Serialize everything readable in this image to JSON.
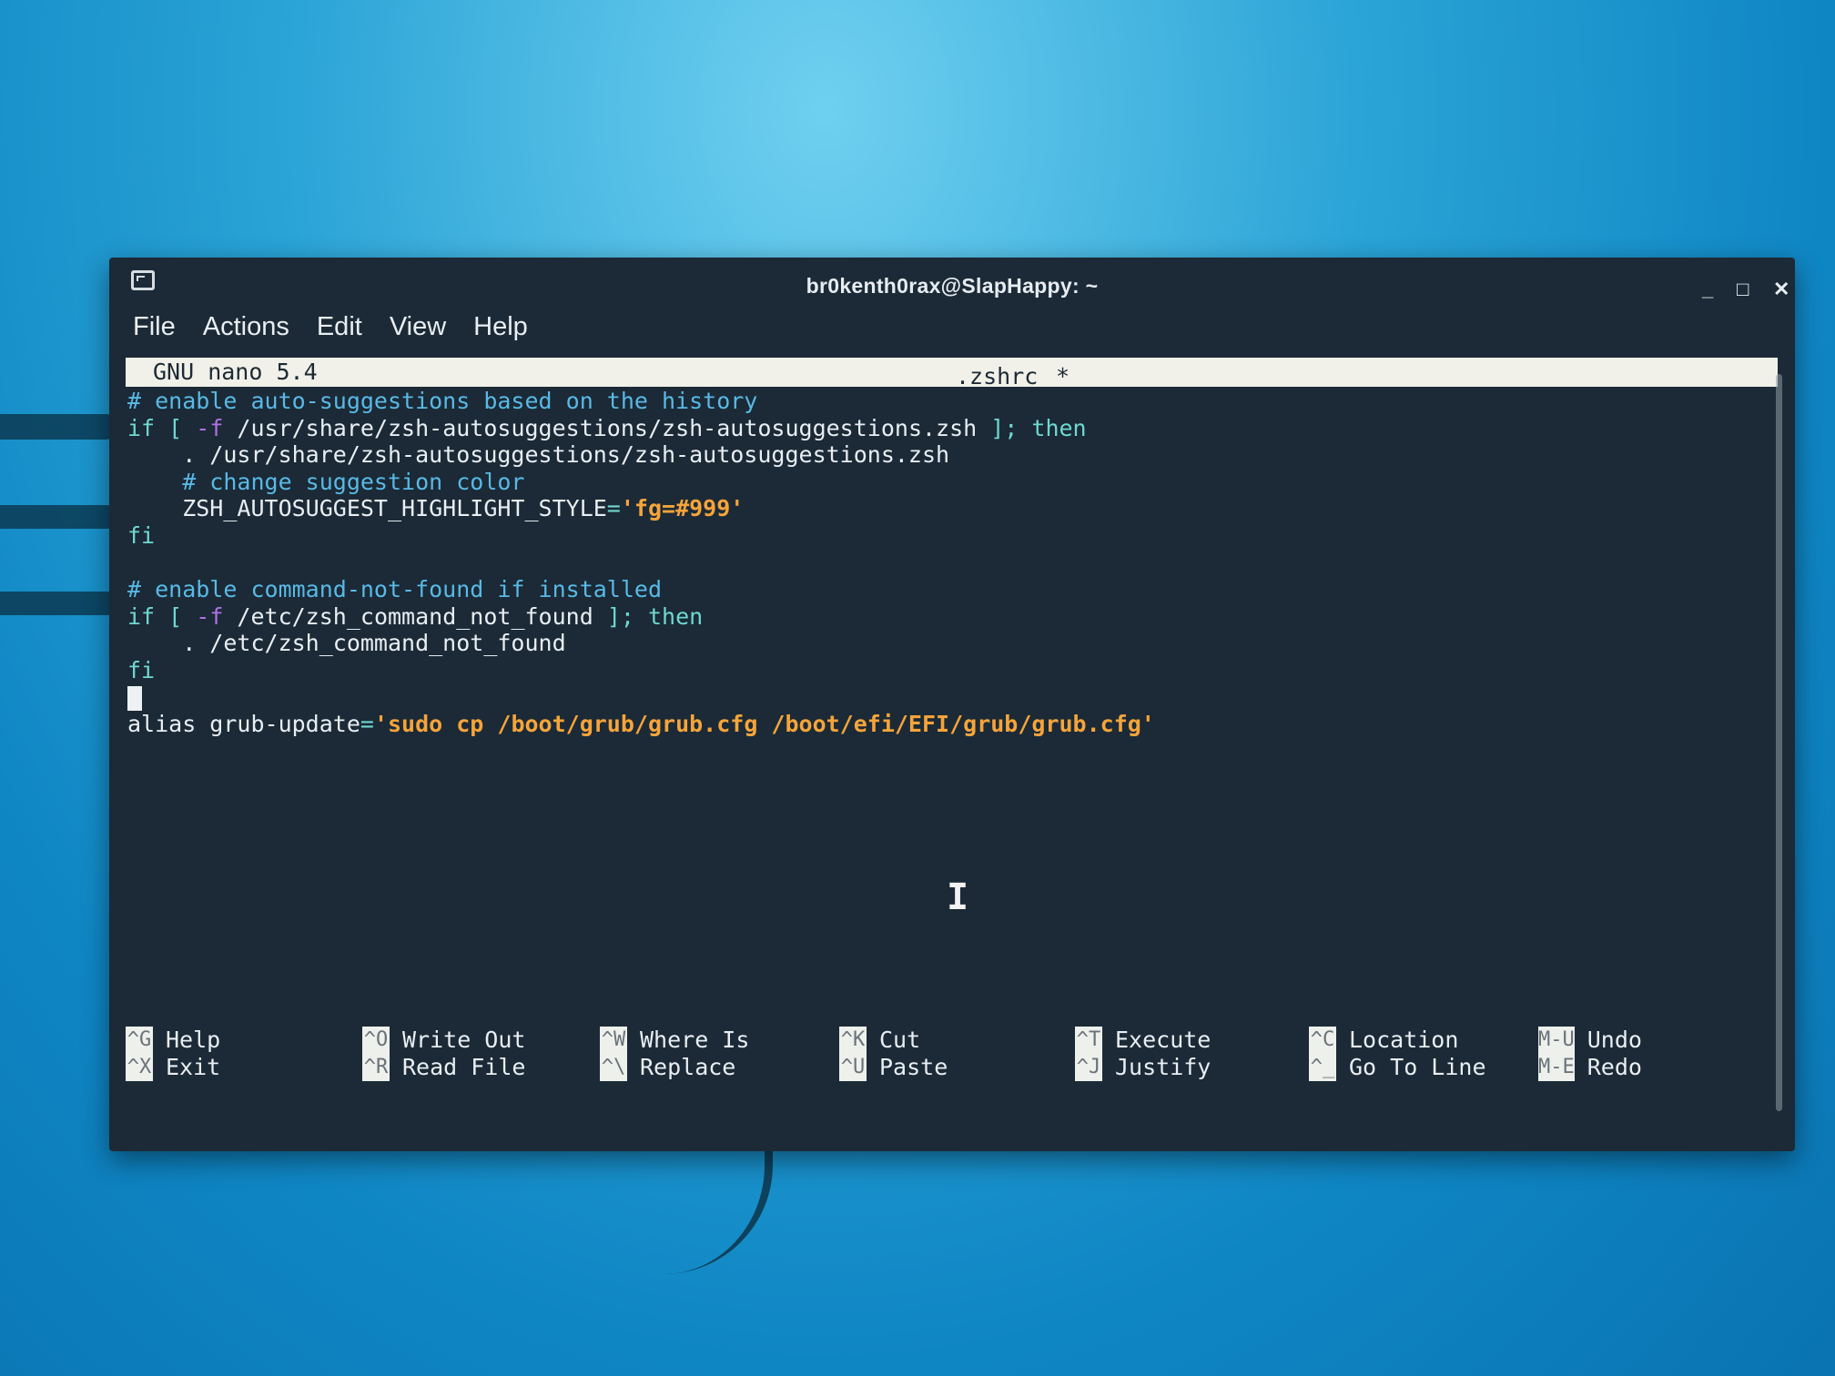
{
  "window": {
    "title": "br0kenth0rax@SlapHappy: ~",
    "controls": {
      "minimize": "_",
      "maximize": "□",
      "close": "✕"
    }
  },
  "menu": [
    "File",
    "Actions",
    "Edit",
    "View",
    "Help"
  ],
  "nano": {
    "version": "GNU nano 5.4",
    "filename": ".zshrc",
    "modified_marker": "*"
  },
  "lines": [
    [
      {
        "t": "# enable auto-suggestions based on the history",
        "c": "cm"
      }
    ],
    [
      {
        "t": "if",
        "c": "kw"
      },
      {
        "t": " [ ",
        "c": "kw"
      },
      {
        "t": "-f",
        "c": "op"
      },
      {
        "t": " /usr/share/zsh-autosuggestions/zsh-autosuggestions.zsh ",
        "c": "pl"
      },
      {
        "t": "]; then",
        "c": "kw"
      }
    ],
    [
      {
        "t": "    . /usr/share/zsh-autosuggestions/zsh-autosuggestions.zsh",
        "c": "pl"
      }
    ],
    [
      {
        "t": "    # change suggestion color",
        "c": "cm"
      }
    ],
    [
      {
        "t": "    ZSH_AUTOSUGGEST_HIGHLIGHT_STYLE",
        "c": "pl"
      },
      {
        "t": "=",
        "c": "kw"
      },
      {
        "t": "'fg=#999'",
        "c": "st"
      }
    ],
    [
      {
        "t": "fi",
        "c": "kw"
      }
    ],
    [],
    [
      {
        "t": "# enable command-not-found if installed",
        "c": "cm"
      }
    ],
    [
      {
        "t": "if",
        "c": "kw"
      },
      {
        "t": " [ ",
        "c": "kw"
      },
      {
        "t": "-f",
        "c": "op"
      },
      {
        "t": " /etc/zsh_command_not_found ",
        "c": "pl"
      },
      {
        "t": "]; then",
        "c": "kw"
      }
    ],
    [
      {
        "t": "    . /etc/zsh_command_not_found",
        "c": "pl"
      }
    ],
    [
      {
        "t": "fi",
        "c": "kw"
      }
    ],
    [
      {
        "cursor": true
      }
    ],
    [
      {
        "t": "alias grub-update",
        "c": "pl"
      },
      {
        "t": "=",
        "c": "kw"
      },
      {
        "t": "'sudo cp /boot/grub/grub.cfg /boot/efi/EFI/grub/grub.cfg'",
        "c": "st"
      }
    ]
  ],
  "shortcuts": [
    {
      "top": {
        "key": "^G",
        "label": "Help"
      },
      "bottom": {
        "key": "^X",
        "label": "Exit"
      }
    },
    {
      "top": {
        "key": "^O",
        "label": "Write Out"
      },
      "bottom": {
        "key": "^R",
        "label": "Read File"
      }
    },
    {
      "top": {
        "key": "^W",
        "label": "Where Is"
      },
      "bottom": {
        "key": "^\\",
        "label": "Replace"
      }
    },
    {
      "top": {
        "key": "^K",
        "label": "Cut"
      },
      "bottom": {
        "key": "^U",
        "label": "Paste"
      }
    },
    {
      "top": {
        "key": "^T",
        "label": "Execute"
      },
      "bottom": {
        "key": "^J",
        "label": "Justify"
      }
    },
    {
      "top": {
        "key": "^C",
        "label": "Location"
      },
      "bottom": {
        "key": "^_",
        "label": "Go To Line"
      }
    },
    {
      "top": {
        "key": "M-U",
        "label": "Undo"
      },
      "bottom": {
        "key": "M-E",
        "label": "Redo"
      }
    }
  ],
  "colors": {
    "comment": "#59b9e6",
    "keyword": "#6fd8d2",
    "flag": "#b070e6",
    "string": "#f6a43a",
    "terminal_bg": "#1b2a36"
  }
}
